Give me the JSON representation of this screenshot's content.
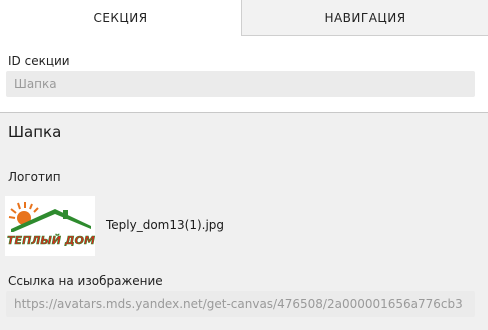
{
  "tabs": [
    {
      "label": "СЕКЦИЯ",
      "active": true
    },
    {
      "label": "НАВИГАЦИЯ",
      "active": false
    }
  ],
  "section_id": {
    "label": "ID секции",
    "value": "Шапка"
  },
  "section_title": "Шапка",
  "logo": {
    "label": "Логотип",
    "image_text": "ТЕПЛЫЙ ДОМ",
    "file_name": "Teply_dom13(1).jpg"
  },
  "image_link": {
    "label": "Ссылка на изображение",
    "value": "https://avatars.mds.yandex.net/get-canvas/476508/2a000001656a776cb3"
  },
  "colors": {
    "logo_green": "#2e8b2e",
    "logo_red": "#d8281e",
    "logo_orange": "#e8731c"
  }
}
